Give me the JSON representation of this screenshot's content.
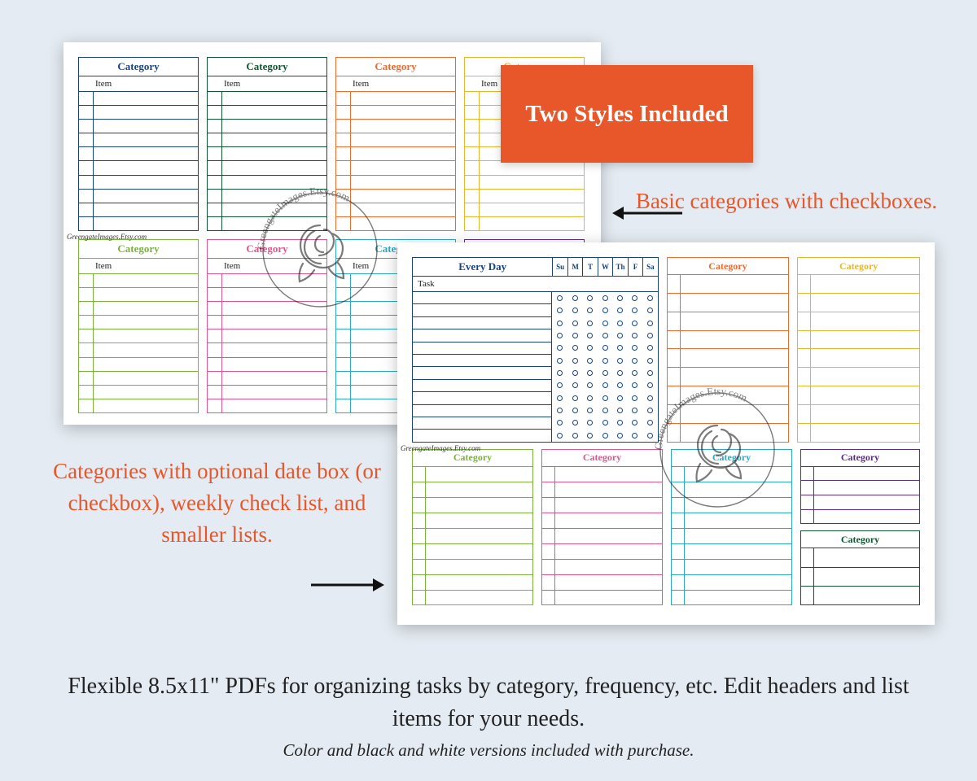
{
  "badge_text": "Two Styles Included",
  "anno_right": "Basic categories with checkboxes.",
  "anno_left": "Categories with optional date box (or checkbox), weekly check list, and smaller lists.",
  "caption_main": "Flexible 8.5x11\" PDFs for organizing tasks by category, frequency, etc. Edit headers and list items for your needs.",
  "caption_sub": "Color and black and white versions included with purchase.",
  "attribution": "GreengateImages.Etsy.com",
  "watermark_text": "GreengateImages.Etsy.com",
  "page1": {
    "item_label": "Item",
    "rows_per_box": 10,
    "boxes": [
      {
        "label": "Category",
        "color": "#17447f"
      },
      {
        "label": "Category",
        "color": "#0d5630"
      },
      {
        "label": "Category",
        "color": "#ef6a2f"
      },
      {
        "label": "Category",
        "color": "#e7b52f"
      },
      {
        "label": "Category",
        "color": "#7ab23c"
      },
      {
        "label": "Category",
        "color": "#e0558f"
      },
      {
        "label": "Category",
        "color": "#2ea9c4"
      },
      {
        "label": "Category",
        "color": "#5b2d84"
      }
    ]
  },
  "page2": {
    "weekly": {
      "header": "Every Day",
      "task_label": "Task",
      "days": [
        "Su",
        "M",
        "T",
        "W",
        "Th",
        "F",
        "Sa"
      ],
      "rows": 12,
      "color": "#17447f"
    },
    "item_label": "",
    "top_right": [
      {
        "label": "Category",
        "color": "#ef6a2f",
        "rows": 9
      },
      {
        "label": "Category",
        "color": "#e7b52f",
        "rows": 9
      }
    ],
    "bottom": [
      {
        "label": "Category",
        "color": "#7ab23c",
        "rows": 9
      },
      {
        "label": "Category",
        "color": "#e0558f",
        "rows": 9
      },
      {
        "label": "Category",
        "color": "#2ea9c4",
        "rows": 9
      }
    ],
    "bottom_stack": [
      {
        "label": "Category",
        "color": "#5b2d84",
        "rows": 4
      },
      {
        "label": "Category",
        "color": "#0d5630",
        "rows": 3
      }
    ]
  }
}
